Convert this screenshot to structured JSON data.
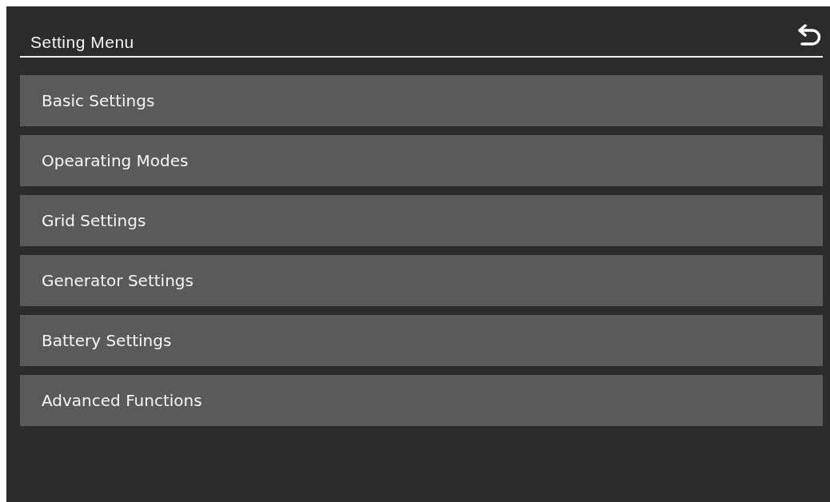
{
  "header": {
    "title": "Setting Menu"
  },
  "menu_items": [
    {
      "label": "Basic Settings"
    },
    {
      "label": "Opearating Modes"
    },
    {
      "label": "Grid Settings"
    },
    {
      "label": "Generator Settings"
    },
    {
      "label": "Battery Settings"
    },
    {
      "label": "Advanced Functions"
    }
  ]
}
